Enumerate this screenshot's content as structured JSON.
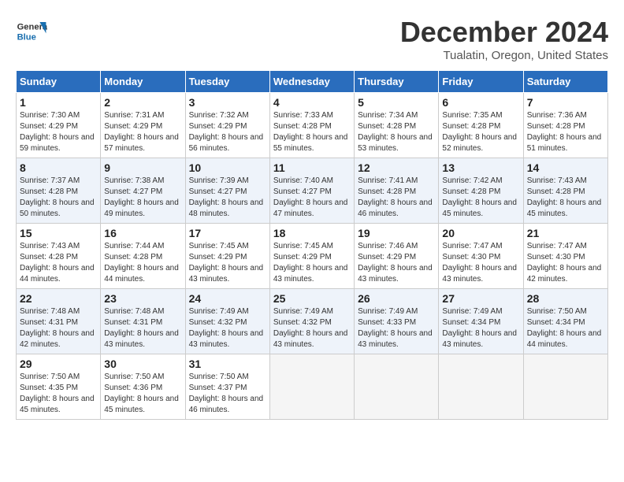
{
  "header": {
    "logo_general": "General",
    "logo_blue": "Blue",
    "month": "December 2024",
    "location": "Tualatin, Oregon, United States"
  },
  "days_of_week": [
    "Sunday",
    "Monday",
    "Tuesday",
    "Wednesday",
    "Thursday",
    "Friday",
    "Saturday"
  ],
  "weeks": [
    [
      {
        "day": "1",
        "sunrise": "Sunrise: 7:30 AM",
        "sunset": "Sunset: 4:29 PM",
        "daylight": "Daylight: 8 hours and 59 minutes."
      },
      {
        "day": "2",
        "sunrise": "Sunrise: 7:31 AM",
        "sunset": "Sunset: 4:29 PM",
        "daylight": "Daylight: 8 hours and 57 minutes."
      },
      {
        "day": "3",
        "sunrise": "Sunrise: 7:32 AM",
        "sunset": "Sunset: 4:29 PM",
        "daylight": "Daylight: 8 hours and 56 minutes."
      },
      {
        "day": "4",
        "sunrise": "Sunrise: 7:33 AM",
        "sunset": "Sunset: 4:28 PM",
        "daylight": "Daylight: 8 hours and 55 minutes."
      },
      {
        "day": "5",
        "sunrise": "Sunrise: 7:34 AM",
        "sunset": "Sunset: 4:28 PM",
        "daylight": "Daylight: 8 hours and 53 minutes."
      },
      {
        "day": "6",
        "sunrise": "Sunrise: 7:35 AM",
        "sunset": "Sunset: 4:28 PM",
        "daylight": "Daylight: 8 hours and 52 minutes."
      },
      {
        "day": "7",
        "sunrise": "Sunrise: 7:36 AM",
        "sunset": "Sunset: 4:28 PM",
        "daylight": "Daylight: 8 hours and 51 minutes."
      }
    ],
    [
      {
        "day": "8",
        "sunrise": "Sunrise: 7:37 AM",
        "sunset": "Sunset: 4:28 PM",
        "daylight": "Daylight: 8 hours and 50 minutes."
      },
      {
        "day": "9",
        "sunrise": "Sunrise: 7:38 AM",
        "sunset": "Sunset: 4:27 PM",
        "daylight": "Daylight: 8 hours and 49 minutes."
      },
      {
        "day": "10",
        "sunrise": "Sunrise: 7:39 AM",
        "sunset": "Sunset: 4:27 PM",
        "daylight": "Daylight: 8 hours and 48 minutes."
      },
      {
        "day": "11",
        "sunrise": "Sunrise: 7:40 AM",
        "sunset": "Sunset: 4:27 PM",
        "daylight": "Daylight: 8 hours and 47 minutes."
      },
      {
        "day": "12",
        "sunrise": "Sunrise: 7:41 AM",
        "sunset": "Sunset: 4:28 PM",
        "daylight": "Daylight: 8 hours and 46 minutes."
      },
      {
        "day": "13",
        "sunrise": "Sunrise: 7:42 AM",
        "sunset": "Sunset: 4:28 PM",
        "daylight": "Daylight: 8 hours and 45 minutes."
      },
      {
        "day": "14",
        "sunrise": "Sunrise: 7:43 AM",
        "sunset": "Sunset: 4:28 PM",
        "daylight": "Daylight: 8 hours and 45 minutes."
      }
    ],
    [
      {
        "day": "15",
        "sunrise": "Sunrise: 7:43 AM",
        "sunset": "Sunset: 4:28 PM",
        "daylight": "Daylight: 8 hours and 44 minutes."
      },
      {
        "day": "16",
        "sunrise": "Sunrise: 7:44 AM",
        "sunset": "Sunset: 4:28 PM",
        "daylight": "Daylight: 8 hours and 44 minutes."
      },
      {
        "day": "17",
        "sunrise": "Sunrise: 7:45 AM",
        "sunset": "Sunset: 4:29 PM",
        "daylight": "Daylight: 8 hours and 43 minutes."
      },
      {
        "day": "18",
        "sunrise": "Sunrise: 7:45 AM",
        "sunset": "Sunset: 4:29 PM",
        "daylight": "Daylight: 8 hours and 43 minutes."
      },
      {
        "day": "19",
        "sunrise": "Sunrise: 7:46 AM",
        "sunset": "Sunset: 4:29 PM",
        "daylight": "Daylight: 8 hours and 43 minutes."
      },
      {
        "day": "20",
        "sunrise": "Sunrise: 7:47 AM",
        "sunset": "Sunset: 4:30 PM",
        "daylight": "Daylight: 8 hours and 43 minutes."
      },
      {
        "day": "21",
        "sunrise": "Sunrise: 7:47 AM",
        "sunset": "Sunset: 4:30 PM",
        "daylight": "Daylight: 8 hours and 42 minutes."
      }
    ],
    [
      {
        "day": "22",
        "sunrise": "Sunrise: 7:48 AM",
        "sunset": "Sunset: 4:31 PM",
        "daylight": "Daylight: 8 hours and 42 minutes."
      },
      {
        "day": "23",
        "sunrise": "Sunrise: 7:48 AM",
        "sunset": "Sunset: 4:31 PM",
        "daylight": "Daylight: 8 hours and 43 minutes."
      },
      {
        "day": "24",
        "sunrise": "Sunrise: 7:49 AM",
        "sunset": "Sunset: 4:32 PM",
        "daylight": "Daylight: 8 hours and 43 minutes."
      },
      {
        "day": "25",
        "sunrise": "Sunrise: 7:49 AM",
        "sunset": "Sunset: 4:32 PM",
        "daylight": "Daylight: 8 hours and 43 minutes."
      },
      {
        "day": "26",
        "sunrise": "Sunrise: 7:49 AM",
        "sunset": "Sunset: 4:33 PM",
        "daylight": "Daylight: 8 hours and 43 minutes."
      },
      {
        "day": "27",
        "sunrise": "Sunrise: 7:49 AM",
        "sunset": "Sunset: 4:34 PM",
        "daylight": "Daylight: 8 hours and 43 minutes."
      },
      {
        "day": "28",
        "sunrise": "Sunrise: 7:50 AM",
        "sunset": "Sunset: 4:34 PM",
        "daylight": "Daylight: 8 hours and 44 minutes."
      }
    ],
    [
      {
        "day": "29",
        "sunrise": "Sunrise: 7:50 AM",
        "sunset": "Sunset: 4:35 PM",
        "daylight": "Daylight: 8 hours and 45 minutes."
      },
      {
        "day": "30",
        "sunrise": "Sunrise: 7:50 AM",
        "sunset": "Sunset: 4:36 PM",
        "daylight": "Daylight: 8 hours and 45 minutes."
      },
      {
        "day": "31",
        "sunrise": "Sunrise: 7:50 AM",
        "sunset": "Sunset: 4:37 PM",
        "daylight": "Daylight: 8 hours and 46 minutes."
      },
      null,
      null,
      null,
      null
    ]
  ]
}
